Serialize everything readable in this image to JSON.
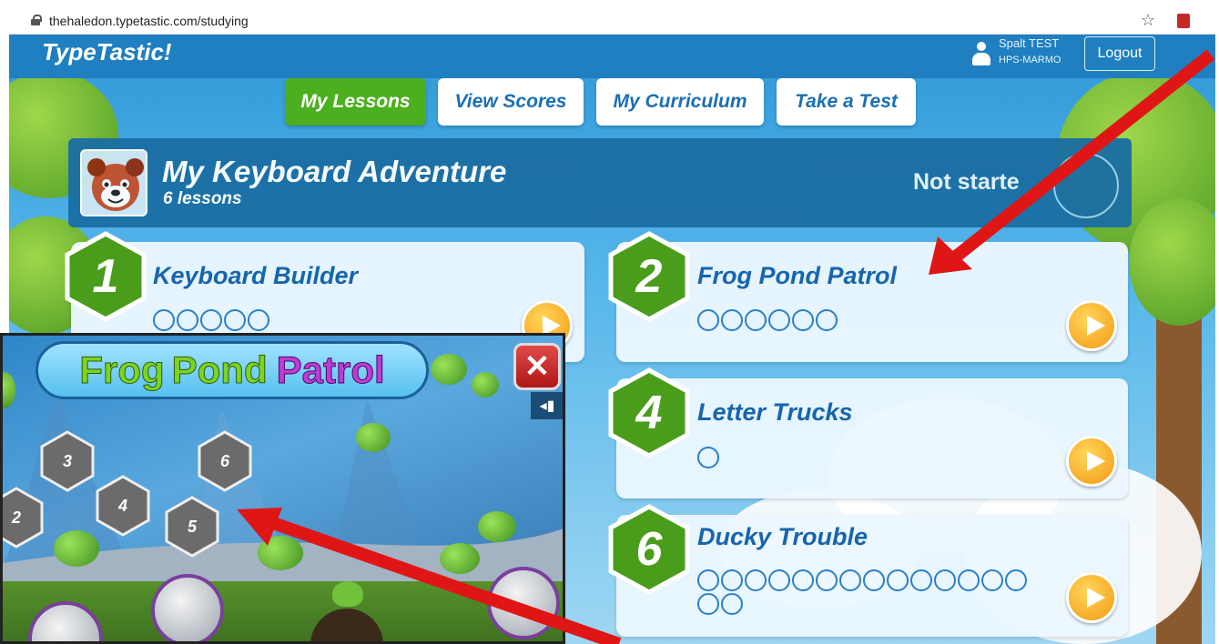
{
  "browser": {
    "url": "thehaledon.typetastic.com/studying"
  },
  "app": {
    "logo": "TypeTastic!",
    "user_name": "Spalt TEST",
    "user_org": "HPS-MARMO",
    "logout_label": "Logout"
  },
  "tabs": [
    {
      "label": "My Lessons",
      "active": true
    },
    {
      "label": "View Scores",
      "active": false
    },
    {
      "label": "My Curriculum",
      "active": false
    },
    {
      "label": "Take a Test",
      "active": false
    }
  ],
  "adventure": {
    "title": "My Keyboard Adventure",
    "subtitle": "6 lessons",
    "status": "Not starte"
  },
  "lessons": [
    {
      "number": "1",
      "title": "Keyboard Builder",
      "dots": 5
    },
    {
      "number": "2",
      "title": "Frog Pond Patrol",
      "dots": 6
    },
    {
      "number": "4",
      "title": "Letter Trucks",
      "dots": 1
    },
    {
      "number": "6",
      "title": "Ducky Trouble",
      "dots": 16
    }
  ],
  "game": {
    "title_part1": "Frog",
    "title_part2": "Pond",
    "title_part3": "Patrol",
    "close_symbol": "✕",
    "sound_symbol": "◂▮",
    "level_buttons": [
      "2",
      "3",
      "4",
      "5",
      "6"
    ]
  },
  "colors": {
    "accent_green": "#4caf1f",
    "title_blue": "#1765ad",
    "arrow_red": "#e01515",
    "play_orange": "#f39a12"
  }
}
